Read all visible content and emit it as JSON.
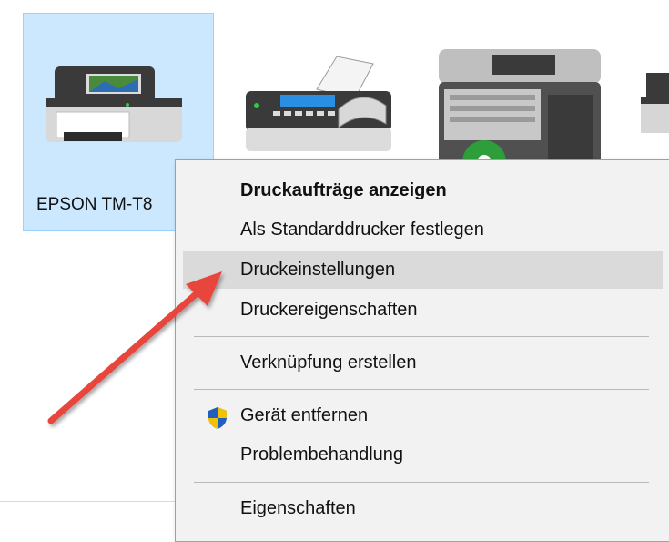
{
  "devices": [
    {
      "label": "EPSON TM-T8",
      "icon": "printer-icon",
      "selected": true
    },
    {
      "label": "",
      "icon": "fax-icon",
      "selected": false
    },
    {
      "label": "",
      "icon": "multifunction-printer-icon",
      "selected": false
    },
    {
      "label": "",
      "icon": "printer-icon",
      "selected": false
    }
  ],
  "context_menu": {
    "items": [
      {
        "label": "Druckaufträge anzeigen",
        "bold": true
      },
      {
        "label": "Als Standarddrucker festlegen"
      },
      {
        "label": "Druckeinstellungen",
        "highlighted": true
      },
      {
        "label": "Druckereigenschaften"
      },
      {
        "label": "Verknüpfung erstellen"
      },
      {
        "label": "Gerät entfernen",
        "icon": "uac-shield-icon"
      },
      {
        "label": "Problembehandlung"
      },
      {
        "label": "Eigenschaften"
      }
    ]
  },
  "colors": {
    "selection_bg": "#cce8ff",
    "selection_border": "#99d1ff",
    "menu_bg": "#f2f2f2",
    "menu_hover": "#dadada",
    "annotation_arrow": "#e8453c"
  },
  "annotation": {
    "type": "arrow",
    "points_to": "Druckeinstellungen"
  }
}
